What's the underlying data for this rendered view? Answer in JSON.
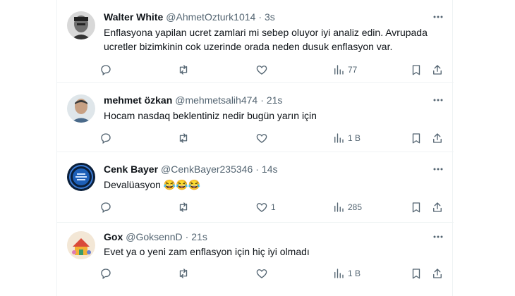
{
  "tweets": [
    {
      "name": "Walter White",
      "handle": "@AhmetOzturk1014",
      "time": "3s",
      "text": "Enflasyona yapilan ucret zamlari mi sebep oluyor iyi analiz edin. Avrupada ucretler bizimkinin cok uzerinde orada neden dusuk enflasyon var.",
      "likes": "",
      "views": "77"
    },
    {
      "name": "mehmet özkan",
      "handle": "@mehmetsalih474",
      "time": "21s",
      "text": "Hocam nasdaq beklentiniz nedir bugün yarın için",
      "likes": "",
      "views": "1 B"
    },
    {
      "name": "Cenk Bayer",
      "handle": "@CenkBayer235346",
      "time": "14s",
      "text": "Devalüasyon",
      "emoji": "😂😂😂",
      "likes": "1",
      "views": "285"
    },
    {
      "name": "Gox",
      "handle": "@GoksennD",
      "time": "21s",
      "text": "Evet ya o yeni zam enflasyon için hiç iyi olmadı",
      "likes": "",
      "views": "1 B"
    }
  ],
  "separator": "·",
  "colors": {
    "text": "#0f1419",
    "secondary": "#536471",
    "border": "#eff3f4"
  },
  "icons": [
    "reply-icon",
    "retweet-icon",
    "like-icon",
    "views-icon",
    "bookmark-icon",
    "share-icon",
    "more-icon"
  ]
}
